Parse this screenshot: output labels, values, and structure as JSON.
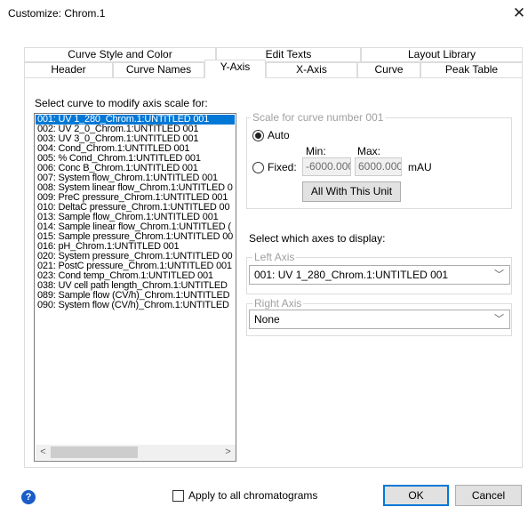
{
  "window": {
    "title": "Customize: Chrom.1",
    "close_glyph": "✕"
  },
  "tabs": {
    "row1": [
      "Curve Style and Color",
      "Edit Texts",
      "Layout Library"
    ],
    "row2": [
      "Header",
      "Curve Names",
      "Y-Axis",
      "X-Axis",
      "Curve",
      "Peak Table"
    ],
    "active": "Y-Axis"
  },
  "curve_list": {
    "prompt": "Select curve to modify axis scale for:",
    "items": [
      "001: UV 1_280_Chrom.1:UNTITLED 001",
      "002: UV 2_0_Chrom.1:UNTITLED 001",
      "003: UV 3_0_Chrom.1:UNTITLED 001",
      "004: Cond_Chrom.1:UNTITLED 001",
      "005: % Cond_Chrom.1:UNTITLED 001",
      "006: Conc B_Chrom.1:UNTITLED 001",
      "007: System flow_Chrom.1:UNTITLED 001",
      "008: System linear flow_Chrom.1:UNTITLED 0",
      "009: PreC pressure_Chrom.1:UNTITLED 001",
      "010: DeltaC pressure_Chrom.1:UNTITLED 00",
      "013: Sample flow_Chrom.1:UNTITLED 001",
      "014: Sample linear flow_Chrom.1:UNTITLED (",
      "015: Sample pressure_Chrom.1:UNTITLED 00",
      "016: pH_Chrom.1:UNTITLED 001",
      "020: System pressure_Chrom.1:UNTITLED 00",
      "021: PostC pressure_Chrom.1:UNTITLED 001",
      "023: Cond temp_Chrom.1:UNTITLED 001",
      "038: UV cell path length_Chrom.1:UNTITLED",
      "089: Sample flow (CV/h)_Chrom.1:UNTITLED",
      "090: System flow (CV/h)_Chrom.1:UNTITLED"
    ],
    "selected_index": 0,
    "scroll_left": "<",
    "scroll_right": ">"
  },
  "scale": {
    "group_label": "Scale for curve number 001",
    "auto_label": "Auto",
    "fixed_label": "Fixed:",
    "min_label": "Min:",
    "max_label": "Max:",
    "min_value": "-6000.000",
    "max_value": "6000.000",
    "unit": "mAU",
    "selected_mode": "Auto",
    "all_with_unit_label": "All With This Unit"
  },
  "axes": {
    "prompt": "Select which axes to display:",
    "left_axis_label": "Left Axis",
    "left_axis_value": "001: UV 1_280_Chrom.1:UNTITLED 001",
    "right_axis_label": "Right Axis",
    "right_axis_value": "None",
    "dropdown_glyph": "﹀"
  },
  "footer": {
    "help_glyph": "?",
    "apply_all_label": "Apply to all chromatograms",
    "apply_all_checked": false,
    "ok_label": "OK",
    "cancel_label": "Cancel"
  }
}
